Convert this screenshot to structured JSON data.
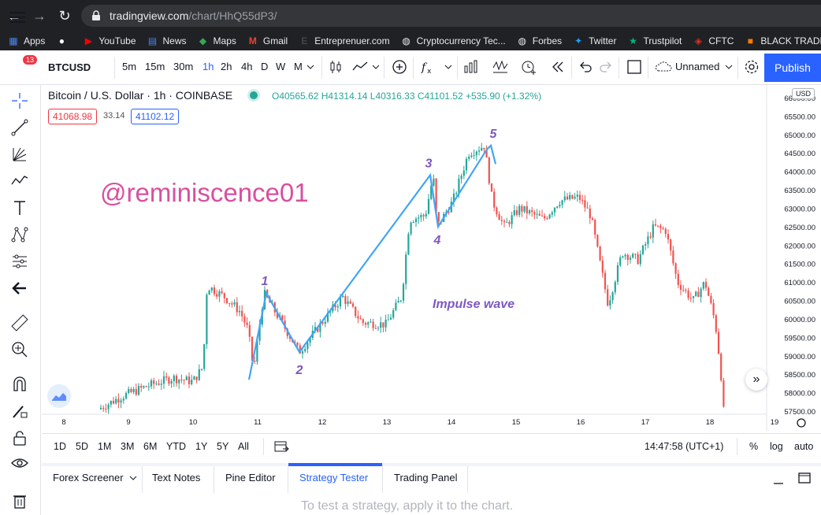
{
  "browser": {
    "url_host": "tradingview.com",
    "url_path": "/chart/HhQ55dP3/",
    "bookmarks": [
      {
        "label": "Apps",
        "icon": "apps-grid-icon"
      },
      {
        "label": "",
        "icon": "chrome-web-icon"
      },
      {
        "label": "YouTube",
        "icon": "youtube-icon"
      },
      {
        "label": "News",
        "icon": "news-icon"
      },
      {
        "label": "Maps",
        "icon": "maps-icon"
      },
      {
        "label": "Gmail",
        "icon": "gmail-icon"
      },
      {
        "label": "Entreprenuer.com",
        "icon": "entrepreneur-icon"
      },
      {
        "label": "Cryptocurrency Tec...",
        "icon": "globe-icon"
      },
      {
        "label": "Forbes",
        "icon": "globe-icon"
      },
      {
        "label": "Twitter",
        "icon": "twitter-icon"
      },
      {
        "label": "Trustpilot",
        "icon": "trustpilot-star-icon"
      },
      {
        "label": "CFTC",
        "icon": "cftc-icon"
      },
      {
        "label": "BLACK TRADER",
        "icon": "blacktrader-icon"
      }
    ]
  },
  "toolbar": {
    "menu_badge": "13",
    "symbol": "BTCUSD",
    "intervals": [
      "5m",
      "15m",
      "30m",
      "1h",
      "2h",
      "4h",
      "D",
      "W",
      "M"
    ],
    "active_interval": "1h",
    "layout_name": "Unnamed",
    "publish_label": "Publish"
  },
  "legend": {
    "title": "Bitcoin / U.S. Dollar · 1h · COINBASE",
    "ohlc": "O40565.62 H41314.14 L40316.33 C41101.52 +535.90 (+1.32%)",
    "bid": "41068.98",
    "spread": "33.14",
    "ask": "41102.12",
    "currency": "USD"
  },
  "watermark": "@reminiscence01",
  "annotations": {
    "wave_labels": [
      "1",
      "2",
      "3",
      "4",
      "5"
    ],
    "impulse_label": "Impulse wave"
  },
  "range_bar": {
    "ranges": [
      "1D",
      "5D",
      "1M",
      "3M",
      "6M",
      "YTD",
      "1Y",
      "5Y",
      "All"
    ],
    "clock": "14:47:58 (UTC+1)",
    "percent": "%",
    "log": "log",
    "auto": "auto"
  },
  "panel": {
    "tabs": [
      "Forex Screener",
      "Text Notes",
      "Pine Editor",
      "Strategy Tester",
      "Trading Panel"
    ],
    "active_tab": "Strategy Tester",
    "message": "To test a strategy, apply it to the chart."
  },
  "colors": {
    "up": "#26a69a",
    "down": "#ef5350",
    "wave_line": "#42a5f5",
    "wave_label": "#7e57c2",
    "watermark": "#d84fa0",
    "accent": "#2962ff"
  },
  "chart_data": {
    "type": "candlestick",
    "price_axis": [
      "66000.00",
      "65500.00",
      "65000.00",
      "64500.00",
      "64000.00",
      "63500.00",
      "63000.00",
      "62500.00",
      "62000.00",
      "61500.00",
      "61000.00",
      "60500.00",
      "60000.00",
      "59500.00",
      "59000.00",
      "58500.00",
      "58000.00",
      "57500.00"
    ],
    "time_axis": [
      "8",
      "9",
      "10",
      "11",
      "12",
      "13",
      "14",
      "15",
      "16",
      "17",
      "18",
      "19"
    ],
    "wave_points": [
      {
        "label": "1",
        "value": 60700
      },
      {
        "label": "2",
        "value": 59100
      },
      {
        "label": "3",
        "value": 63900
      },
      {
        "label": "4",
        "value": 62500
      },
      {
        "label": "5",
        "value": 64700
      }
    ],
    "ylim": [
      57500,
      66000
    ]
  }
}
